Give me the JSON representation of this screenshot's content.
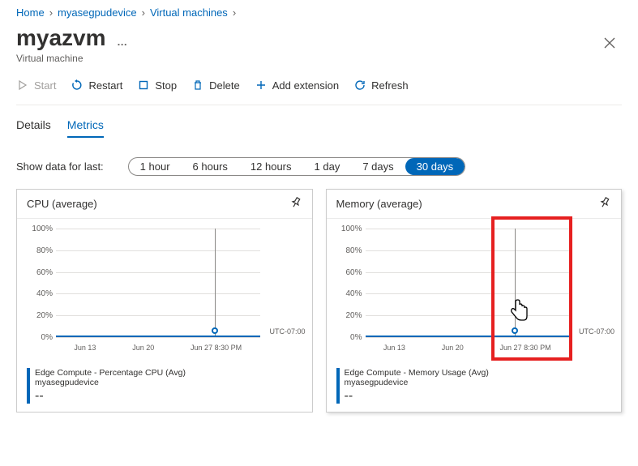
{
  "breadcrumb": {
    "items": [
      "Home",
      "myasegpudevice",
      "Virtual machines"
    ]
  },
  "page": {
    "title": "myazvm",
    "subtitle": "Virtual machine",
    "more": "…"
  },
  "toolbar": {
    "start": "Start",
    "restart": "Restart",
    "stop": "Stop",
    "delete": "Delete",
    "add_extension": "Add extension",
    "refresh": "Refresh"
  },
  "tabs": {
    "details": "Details",
    "metrics": "Metrics"
  },
  "filter": {
    "label": "Show data for last:",
    "options": [
      "1 hour",
      "6 hours",
      "12 hours",
      "1 day",
      "7 days",
      "30 days"
    ],
    "active": "30 days"
  },
  "chart_data": [
    {
      "type": "line",
      "title": "CPU (average)",
      "ylabels": [
        "100%",
        "80%",
        "60%",
        "40%",
        "20%",
        "0%"
      ],
      "xlabels": [
        "Jun 13",
        "Jun 20",
        "Jun 27 8:30 PM"
      ],
      "timezone": "UTC-07:00",
      "legend_title": "Edge Compute - Percentage CPU (Avg)",
      "legend_sub": "myasegpudevice",
      "legend_value": "--",
      "series_value_baseline": 0
    },
    {
      "type": "line",
      "title": "Memory (average)",
      "ylabels": [
        "100%",
        "80%",
        "60%",
        "40%",
        "20%",
        "0%"
      ],
      "xlabels": [
        "Jun 13",
        "Jun 20",
        "Jun 27 8:30 PM"
      ],
      "timezone": "UTC-07:00",
      "legend_title": "Edge Compute - Memory Usage (Avg)",
      "legend_sub": "myasegpudevice",
      "legend_value": "--",
      "series_value_baseline": 0
    }
  ]
}
